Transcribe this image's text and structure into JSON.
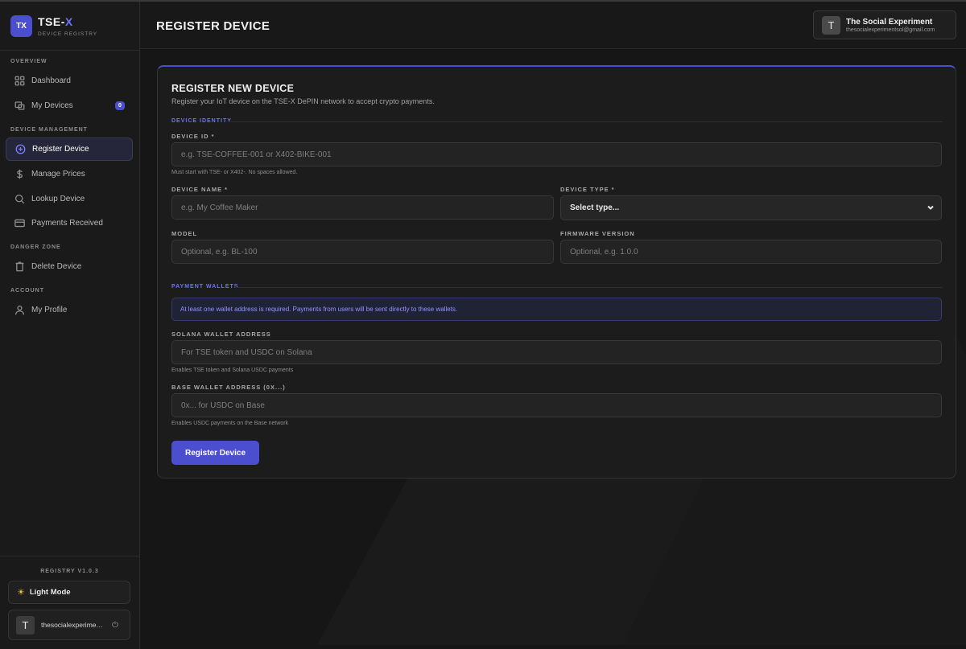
{
  "brand": {
    "logo": "TX",
    "name_main": "TSE-",
    "name_accent": "X",
    "subtitle": "DEVICE REGISTRY"
  },
  "sidebar": {
    "sections": {
      "overview": "OVERVIEW",
      "device_management": "DEVICE MANAGEMENT",
      "danger_zone": "DANGER ZONE",
      "account": "ACCOUNT"
    },
    "items": {
      "dashboard": {
        "label": "Dashboard",
        "icon": "grid-icon"
      },
      "my_devices": {
        "label": "My Devices",
        "icon": "devices-icon",
        "badge": "0"
      },
      "register_device": {
        "label": "Register Device",
        "icon": "plus-circle-icon",
        "active": true
      },
      "manage_prices": {
        "label": "Manage Prices",
        "icon": "dollar-icon"
      },
      "lookup_device": {
        "label": "Lookup Device",
        "icon": "search-icon"
      },
      "payments_received": {
        "label": "Payments Received",
        "icon": "card-icon"
      },
      "delete_device": {
        "label": "Delete Device",
        "icon": "trash-icon"
      },
      "my_profile": {
        "label": "My Profile",
        "icon": "user-icon"
      }
    },
    "version": "REGISTRY V1.0.3",
    "mode_toggle": "Light Mode",
    "user": {
      "initial": "T",
      "name": "thesocialexperimentsol@gmail.com"
    }
  },
  "header": {
    "title": "REGISTER DEVICE",
    "user": {
      "initial": "T",
      "name": "The Social Experiment",
      "email": "thesocialexperimentsol@gmail.com"
    }
  },
  "form": {
    "title": "REGISTER NEW DEVICE",
    "subtitle": "Register your IoT device on the TSE-X DePIN network to accept crypto payments.",
    "identity_group": "DEVICE IDENTITY",
    "device_id": {
      "label": "DEVICE ID *",
      "placeholder": "e.g. TSE-COFFEE-001 or X402-BIKE-001",
      "hint": "Must start with TSE- or X402-. No spaces allowed."
    },
    "device_name": {
      "label": "DEVICE NAME *",
      "placeholder": "e.g. My Coffee Maker"
    },
    "device_type": {
      "label": "DEVICE TYPE *",
      "value": "Select type..."
    },
    "model": {
      "label": "MODEL",
      "placeholder": "Optional, e.g. BL-100"
    },
    "firmware": {
      "label": "FIRMWARE VERSION",
      "placeholder": "Optional, e.g. 1.0.0"
    },
    "wallets_group": "PAYMENT WALLETS",
    "wallet_notice": "At least one wallet address is required. Payments from users will be sent directly to these wallets.",
    "solana": {
      "label": "SOLANA WALLET ADDRESS",
      "placeholder": "For TSE token and USDC on Solana",
      "hint": "Enables TSE token and Solana USDC payments"
    },
    "base": {
      "label": "BASE WALLET ADDRESS (0X...)",
      "placeholder": "0x... for USDC on Base",
      "hint": "Enables USDC payments on the Base network"
    },
    "submit": "Register Device"
  },
  "colors": {
    "accent": "#4b4fcf",
    "accent_text": "#6d72ff",
    "background": "#141414"
  }
}
